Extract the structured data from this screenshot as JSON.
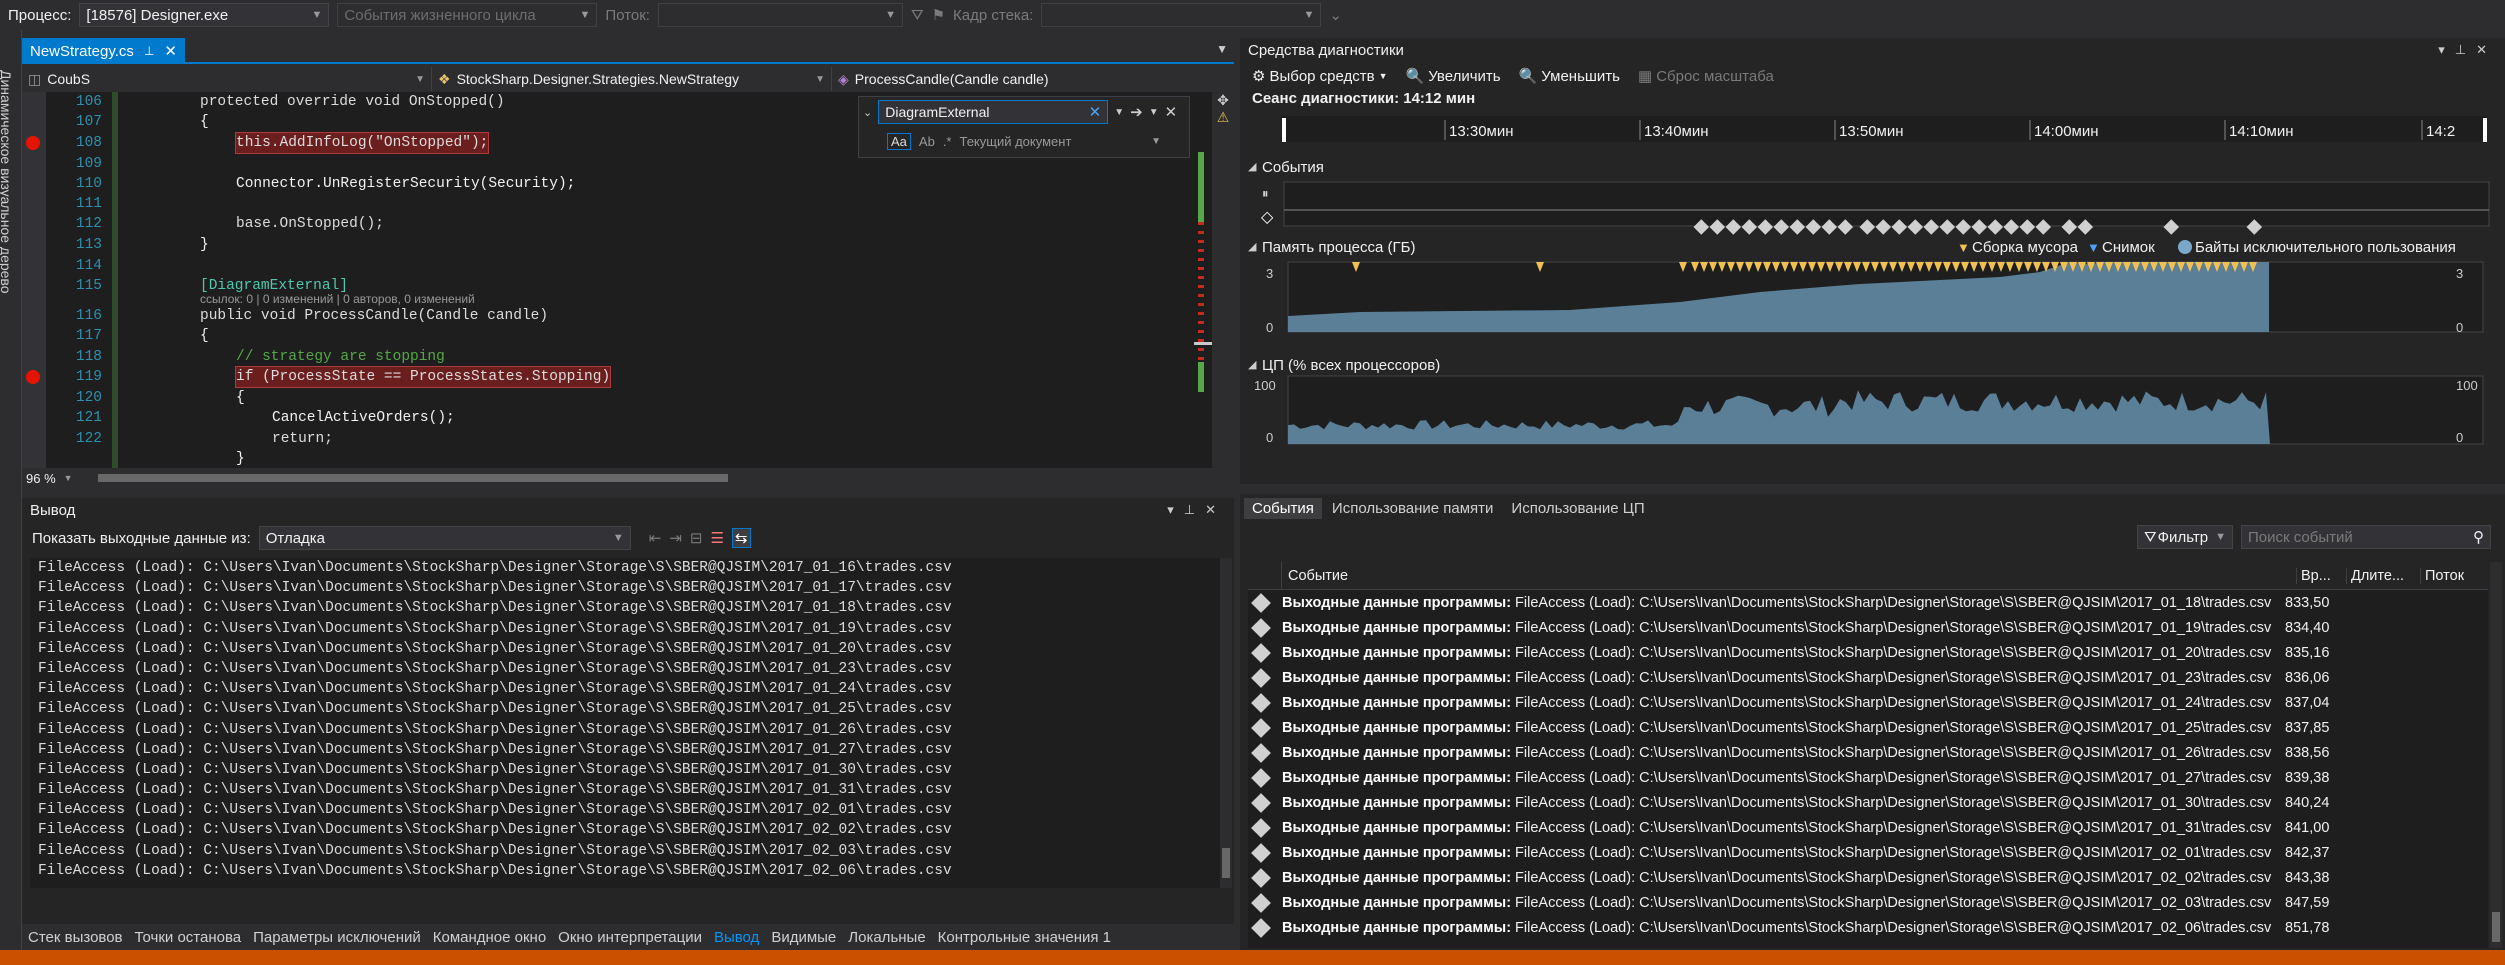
{
  "top": {
    "process_label": "Процесс:",
    "process_value": "[18576] Designer.exe",
    "lifecycle": "События жизненного цикла",
    "thread_label": "Поток:",
    "stackframe_label": "Кадр стека:"
  },
  "sidebar": {
    "vertical": "Динамическое визуальное дерево"
  },
  "editor": {
    "tab": "NewStrategy.cs",
    "nav_left": "CoubS",
    "nav_mid": "StockSharp.Designer.Strategies.NewStrategy",
    "nav_right": "ProcessCandle(Candle candle)",
    "zoom": "96 %",
    "lens": "ссылок: 0 | 0 изменений | 0 авторов, 0 изменений",
    "find_text": "DiagramExternal",
    "find_scope": "Текущий документ",
    "lines": [
      {
        "n": "106",
        "t": "protected override void OnStopped()"
      },
      {
        "n": "107",
        "t": "{"
      },
      {
        "n": "108",
        "t": "this.AddInfoLog(\"OnStopped\");"
      },
      {
        "n": "109",
        "t": ""
      },
      {
        "n": "110",
        "t": "Connector.UnRegisterSecurity(Security);"
      },
      {
        "n": "111",
        "t": ""
      },
      {
        "n": "112",
        "t": "base.OnStopped();"
      },
      {
        "n": "113",
        "t": "}"
      },
      {
        "n": "114",
        "t": ""
      },
      {
        "n": "115",
        "t": "[DiagramExternal]"
      },
      {
        "n": "116",
        "t": "public void ProcessCandle(Candle candle)"
      },
      {
        "n": "117",
        "t": "{"
      },
      {
        "n": "118",
        "t": "// strategy are stopping"
      },
      {
        "n": "119",
        "t": "if (ProcessState == ProcessStates.Stopping)"
      },
      {
        "n": "120",
        "t": "{"
      },
      {
        "n": "121",
        "t": "CancelActiveOrders();"
      },
      {
        "n": "122",
        "t": "return;"
      },
      {
        "n": "",
        "t": "}"
      }
    ]
  },
  "diag": {
    "title": "Средства диагностики",
    "select_tools": "Выбор средств",
    "zoom_in": "Увеличить",
    "zoom_out": "Уменьшить",
    "reset_zoom": "Сброс масштаба",
    "session": "Сеанс диагностики: 14:12 мин",
    "ticks": [
      "13:30мин",
      "13:40мин",
      "13:50мин",
      "14:00мин",
      "14:10мин",
      "14:2"
    ],
    "events_label": "События",
    "memory_label": "Память процесса (ГБ)",
    "legend_gc": "Сборка мусора",
    "legend_snapshot": "Снимок",
    "legend_private": "Байты исключительного пользования",
    "mem_max": "3",
    "mem_min": "0",
    "cpu_label": "ЦП (% всех процессоров)",
    "cpu_max": "100",
    "cpu_min": "0",
    "colors": {
      "fill": "#5a7f97",
      "gc": "#f0c050",
      "accent": "#007acc"
    }
  },
  "output": {
    "title": "Вывод",
    "show_from": "Показать выходные данные из:",
    "source": "Отладка",
    "lines": [
      "FileAccess (Load): C:\\Users\\Ivan\\Documents\\StockSharp\\Designer\\Storage\\S\\SBER@QJSIM\\2017_01_16\\trades.csv",
      "FileAccess (Load): C:\\Users\\Ivan\\Documents\\StockSharp\\Designer\\Storage\\S\\SBER@QJSIM\\2017_01_17\\trades.csv",
      "FileAccess (Load): C:\\Users\\Ivan\\Documents\\StockSharp\\Designer\\Storage\\S\\SBER@QJSIM\\2017_01_18\\trades.csv",
      "FileAccess (Load): C:\\Users\\Ivan\\Documents\\StockSharp\\Designer\\Storage\\S\\SBER@QJSIM\\2017_01_19\\trades.csv",
      "FileAccess (Load): C:\\Users\\Ivan\\Documents\\StockSharp\\Designer\\Storage\\S\\SBER@QJSIM\\2017_01_20\\trades.csv",
      "FileAccess (Load): C:\\Users\\Ivan\\Documents\\StockSharp\\Designer\\Storage\\S\\SBER@QJSIM\\2017_01_23\\trades.csv",
      "FileAccess (Load): C:\\Users\\Ivan\\Documents\\StockSharp\\Designer\\Storage\\S\\SBER@QJSIM\\2017_01_24\\trades.csv",
      "FileAccess (Load): C:\\Users\\Ivan\\Documents\\StockSharp\\Designer\\Storage\\S\\SBER@QJSIM\\2017_01_25\\trades.csv",
      "FileAccess (Load): C:\\Users\\Ivan\\Documents\\StockSharp\\Designer\\Storage\\S\\SBER@QJSIM\\2017_01_26\\trades.csv",
      "FileAccess (Load): C:\\Users\\Ivan\\Documents\\StockSharp\\Designer\\Storage\\S\\SBER@QJSIM\\2017_01_27\\trades.csv",
      "FileAccess (Load): C:\\Users\\Ivan\\Documents\\StockSharp\\Designer\\Storage\\S\\SBER@QJSIM\\2017_01_30\\trades.csv",
      "FileAccess (Load): C:\\Users\\Ivan\\Documents\\StockSharp\\Designer\\Storage\\S\\SBER@QJSIM\\2017_01_31\\trades.csv",
      "FileAccess (Load): C:\\Users\\Ivan\\Documents\\StockSharp\\Designer\\Storage\\S\\SBER@QJSIM\\2017_02_01\\trades.csv",
      "FileAccess (Load): C:\\Users\\Ivan\\Documents\\StockSharp\\Designer\\Storage\\S\\SBER@QJSIM\\2017_02_02\\trades.csv",
      "FileAccess (Load): C:\\Users\\Ivan\\Documents\\StockSharp\\Designer\\Storage\\S\\SBER@QJSIM\\2017_02_03\\trades.csv",
      "FileAccess (Load): C:\\Users\\Ivan\\Documents\\StockSharp\\Designer\\Storage\\S\\SBER@QJSIM\\2017_02_06\\trades.csv"
    ]
  },
  "bottom_tabs": [
    "Стек вызовов",
    "Точки останова",
    "Параметры исключений",
    "Командное окно",
    "Окно интерпретации",
    "Вывод",
    "Видимые",
    "Локальные",
    "Контрольные значения 1"
  ],
  "events": {
    "tabs": [
      "События",
      "Использование памяти",
      "Использование ЦП"
    ],
    "filter": "Фильтр",
    "search_placeholder": "Поиск событий",
    "col_event": "Событие",
    "col_time": "Вр...",
    "col_duration": "Длите...",
    "col_thread": "Поток",
    "row_prefix": "Выходные данные программы:",
    "rows": [
      {
        "text": "FileAccess (Load): C:\\Users\\Ivan\\Documents\\StockSharp\\Designer\\Storage\\S\\SBER@QJSIM\\2017_01_18\\trades.csv",
        "time": "833,50"
      },
      {
        "text": "FileAccess (Load): C:\\Users\\Ivan\\Documents\\StockSharp\\Designer\\Storage\\S\\SBER@QJSIM\\2017_01_19\\trades.csv",
        "time": "834,40"
      },
      {
        "text": "FileAccess (Load): C:\\Users\\Ivan\\Documents\\StockSharp\\Designer\\Storage\\S\\SBER@QJSIM\\2017_01_20\\trades.csv",
        "time": "835,16"
      },
      {
        "text": "FileAccess (Load): C:\\Users\\Ivan\\Documents\\StockSharp\\Designer\\Storage\\S\\SBER@QJSIM\\2017_01_23\\trades.csv",
        "time": "836,06"
      },
      {
        "text": "FileAccess (Load): C:\\Users\\Ivan\\Documents\\StockSharp\\Designer\\Storage\\S\\SBER@QJSIM\\2017_01_24\\trades.csv",
        "time": "837,04"
      },
      {
        "text": "FileAccess (Load): C:\\Users\\Ivan\\Documents\\StockSharp\\Designer\\Storage\\S\\SBER@QJSIM\\2017_01_25\\trades.csv",
        "time": "837,85"
      },
      {
        "text": "FileAccess (Load): C:\\Users\\Ivan\\Documents\\StockSharp\\Designer\\Storage\\S\\SBER@QJSIM\\2017_01_26\\trades.csv",
        "time": "838,56"
      },
      {
        "text": "FileAccess (Load): C:\\Users\\Ivan\\Documents\\StockSharp\\Designer\\Storage\\S\\SBER@QJSIM\\2017_01_27\\trades.csv",
        "time": "839,38"
      },
      {
        "text": "FileAccess (Load): C:\\Users\\Ivan\\Documents\\StockSharp\\Designer\\Storage\\S\\SBER@QJSIM\\2017_01_30\\trades.csv",
        "time": "840,24"
      },
      {
        "text": "FileAccess (Load): C:\\Users\\Ivan\\Documents\\StockSharp\\Designer\\Storage\\S\\SBER@QJSIM\\2017_01_31\\trades.csv",
        "time": "841,00"
      },
      {
        "text": "FileAccess (Load): C:\\Users\\Ivan\\Documents\\StockSharp\\Designer\\Storage\\S\\SBER@QJSIM\\2017_02_01\\trades.csv",
        "time": "842,37"
      },
      {
        "text": "FileAccess (Load): C:\\Users\\Ivan\\Documents\\StockSharp\\Designer\\Storage\\S\\SBER@QJSIM\\2017_02_02\\trades.csv",
        "time": "843,38"
      },
      {
        "text": "FileAccess (Load): C:\\Users\\Ivan\\Documents\\StockSharp\\Designer\\Storage\\S\\SBER@QJSIM\\2017_02_03\\trades.csv",
        "time": "847,59"
      },
      {
        "text": "FileAccess (Load): C:\\Users\\Ivan\\Documents\\StockSharp\\Designer\\Storage\\S\\SBER@QJSIM\\2017_02_06\\trades.csv",
        "time": "851,78"
      }
    ]
  }
}
